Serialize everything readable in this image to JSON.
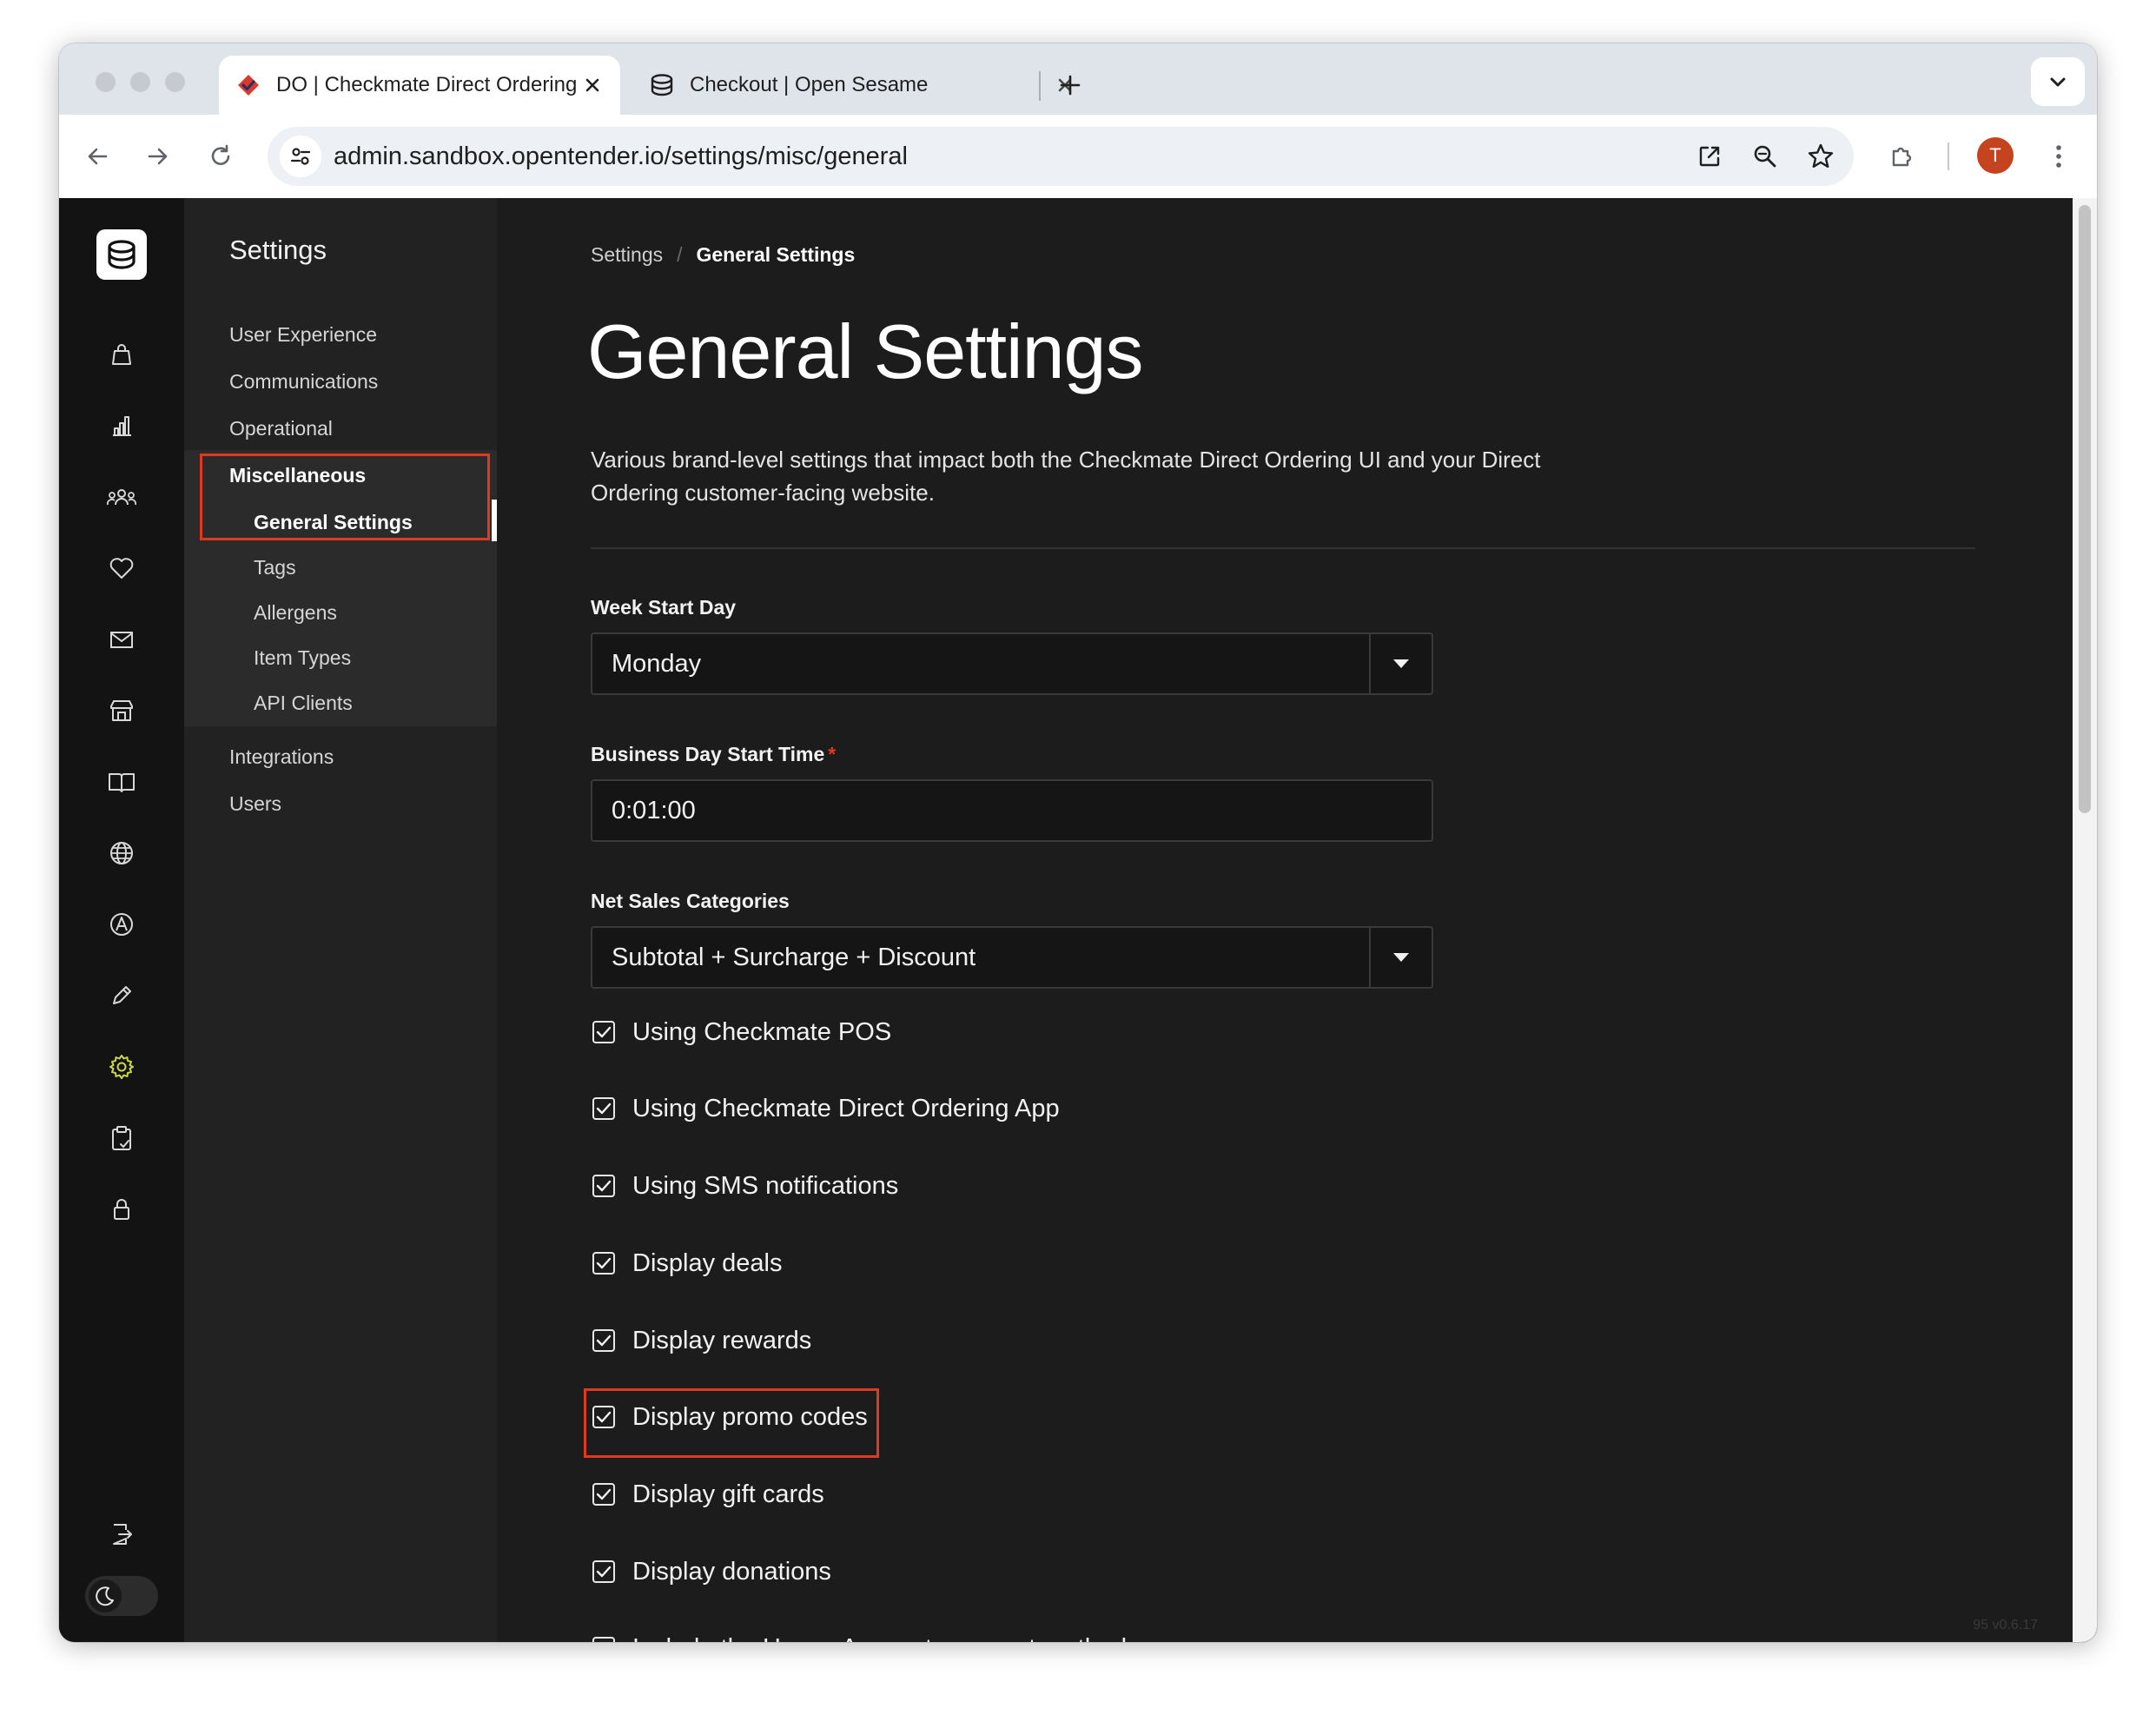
{
  "browser": {
    "tabs": [
      {
        "title": "DO | Checkmate Direct Ordering",
        "active": true
      },
      {
        "title": "Checkout | Open Sesame",
        "active": false
      }
    ],
    "url": "admin.sandbox.opentender.io/settings/misc/general",
    "profile_initial": "T"
  },
  "subnav": {
    "title": "Settings",
    "items": [
      {
        "label": "User Experience"
      },
      {
        "label": "Communications"
      },
      {
        "label": "Operational"
      },
      {
        "label": "Miscellaneous"
      },
      {
        "label": "Integrations"
      },
      {
        "label": "Users"
      }
    ],
    "misc_children": [
      {
        "label": "General Settings",
        "active": true
      },
      {
        "label": "Tags"
      },
      {
        "label": "Allergens"
      },
      {
        "label": "Item Types"
      },
      {
        "label": "API Clients"
      }
    ]
  },
  "breadcrumb": {
    "root": "Settings",
    "separator": "/",
    "current": "General Settings"
  },
  "page": {
    "title": "General Settings",
    "description": "Various brand-level settings that impact both the Checkmate Direct Ordering UI and your Direct Ordering customer-facing website."
  },
  "form": {
    "week_start_day": {
      "label": "Week Start Day",
      "value": "Monday"
    },
    "business_day_start_time": {
      "label": "Business Day Start Time",
      "required_mark": "*",
      "value": "0:01:00"
    },
    "net_sales_categories": {
      "label": "Net Sales Categories",
      "value": "Subtotal + Surcharge + Discount"
    },
    "checkboxes": [
      {
        "label": "Using Checkmate POS",
        "checked": true
      },
      {
        "label": "Using Checkmate Direct Ordering App",
        "checked": true
      },
      {
        "label": "Using SMS notifications",
        "checked": true
      },
      {
        "label": "Display deals",
        "checked": true
      },
      {
        "label": "Display rewards",
        "checked": true
      },
      {
        "label": "Display promo codes",
        "checked": true
      },
      {
        "label": "Display gift cards",
        "checked": true
      },
      {
        "label": "Display donations",
        "checked": true
      },
      {
        "label": "Include the House Account payment method",
        "checked": true
      }
    ]
  },
  "version": "95   v0.6.17",
  "rail_icons": [
    "orders-bag-icon",
    "reports-chart-icon",
    "customers-icon",
    "loyalty-heart-icon",
    "marketing-mail-icon",
    "stores-icon",
    "menus-book-icon",
    "web-globe-icon",
    "brand-a-icon",
    "design-pencil-icon",
    "settings-gear-icon",
    "clipboard-check-icon",
    "lock-icon",
    "logout-icon"
  ],
  "colors": {
    "accent_highlight": "#e03a1e",
    "settings_icon_active": "#c8d84a",
    "background": "#1c1c1c"
  }
}
